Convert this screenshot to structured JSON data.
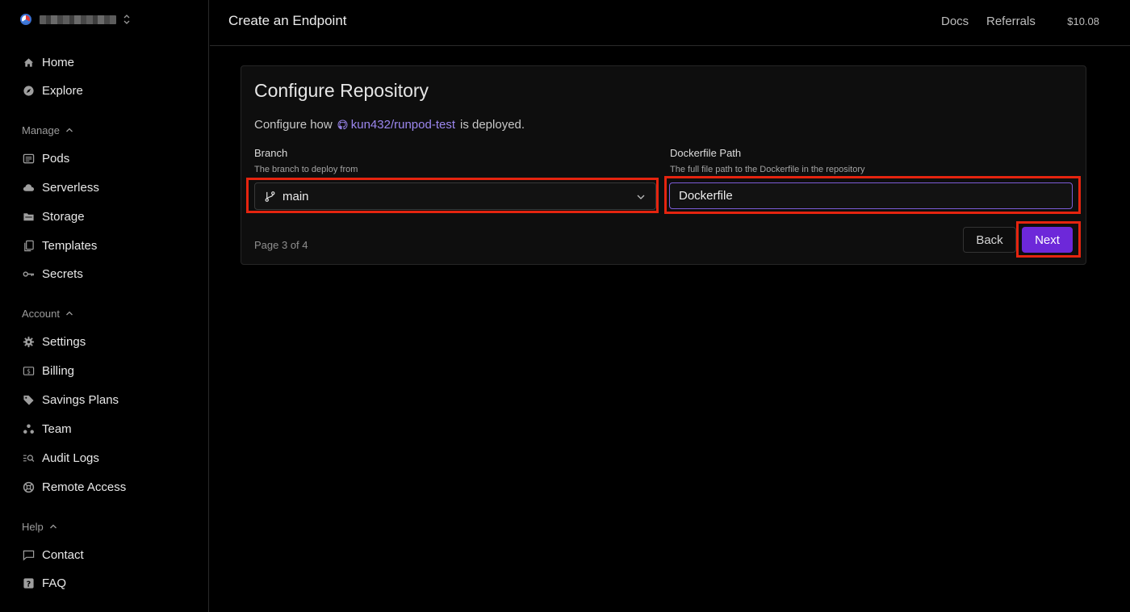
{
  "workspace": {
    "name": "",
    "switch_glyph": "⌃⌄"
  },
  "sidebar": {
    "top_items": [
      {
        "label": "Home",
        "icon": "home-icon"
      },
      {
        "label": "Explore",
        "icon": "compass-icon"
      }
    ],
    "sections": [
      {
        "title": "Manage",
        "items": [
          {
            "label": "Pods",
            "icon": "pods-icon"
          },
          {
            "label": "Serverless",
            "icon": "cloud-icon"
          },
          {
            "label": "Storage",
            "icon": "folder-icon"
          },
          {
            "label": "Templates",
            "icon": "templates-icon"
          },
          {
            "label": "Secrets",
            "icon": "key-icon"
          }
        ]
      },
      {
        "title": "Account",
        "items": [
          {
            "label": "Settings",
            "icon": "gear-icon"
          },
          {
            "label": "Billing",
            "icon": "dollar-icon"
          },
          {
            "label": "Savings Plans",
            "icon": "tag-icon"
          },
          {
            "label": "Team",
            "icon": "team-icon"
          },
          {
            "label": "Audit Logs",
            "icon": "audit-icon"
          },
          {
            "label": "Remote Access",
            "icon": "lifebuoy-icon"
          }
        ]
      },
      {
        "title": "Help",
        "items": [
          {
            "label": "Contact",
            "icon": "chat-icon"
          },
          {
            "label": "FAQ",
            "icon": "question-icon"
          }
        ]
      }
    ]
  },
  "header": {
    "title": "Create an Endpoint",
    "links": [
      "Docs",
      "Referrals"
    ],
    "balance": "$10.08"
  },
  "form": {
    "title": "Configure Repository",
    "description_prefix": "Configure how",
    "repo": "kun432/runpod-test",
    "description_suffix": "is deployed.",
    "branch": {
      "label": "Branch",
      "help": "The branch to deploy from",
      "value": "main"
    },
    "dockerfile": {
      "label": "Dockerfile Path",
      "help": "The full file path to the Dockerfile in the repository",
      "value": "Dockerfile"
    },
    "page_indicator": "Page 3 of 4",
    "back_label": "Back",
    "next_label": "Next"
  },
  "colors": {
    "accent": "#6d28d9",
    "link": "#9c87ef",
    "highlight": "#e5240f",
    "background": "#000000",
    "card": "#0e0e0e"
  }
}
